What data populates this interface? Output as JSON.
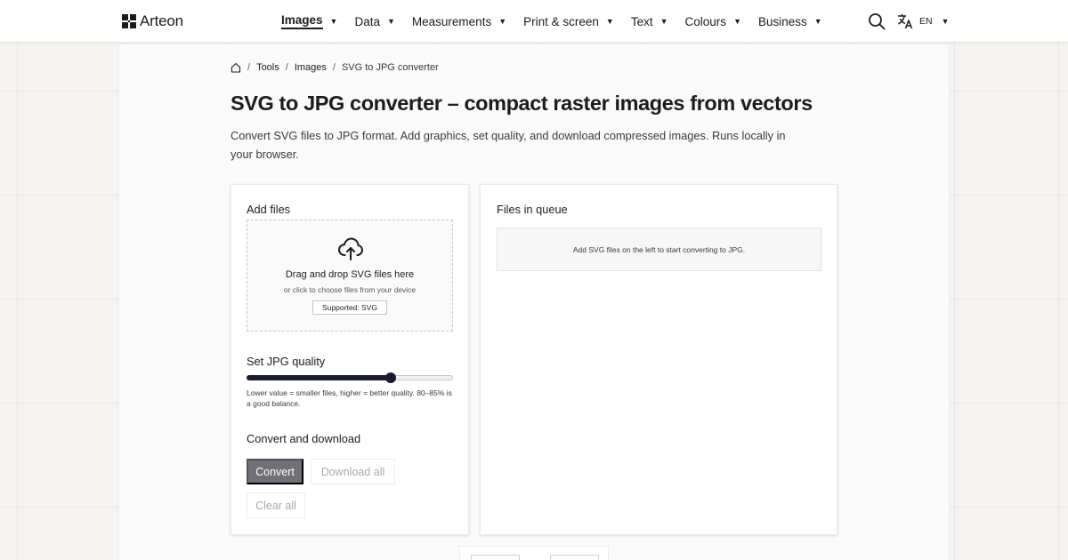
{
  "brand": {
    "name": "Arteon",
    "icon": "arteon-logo-icon"
  },
  "nav": {
    "items": [
      {
        "label": "Images",
        "active": true
      },
      {
        "label": "Data",
        "active": false
      },
      {
        "label": "Measurements",
        "active": false
      },
      {
        "label": "Print & screen",
        "active": false
      },
      {
        "label": "Text",
        "active": false
      },
      {
        "label": "Colours",
        "active": false
      },
      {
        "label": "Business",
        "active": false
      }
    ],
    "caret": "▼",
    "search_icon": "search-icon",
    "language": {
      "icon": "translate-icon",
      "code": "EN"
    }
  },
  "breadcrumb": {
    "home_icon": "home-icon",
    "separator": "/",
    "items": [
      "Tools",
      "Images"
    ],
    "current": "SVG to JPG converter"
  },
  "page": {
    "title": "SVG to JPG converter – compact raster images from vectors",
    "description": "Convert SVG files to JPG format. Add graphics, set quality, and download compressed images. Runs locally in your browser."
  },
  "add_files": {
    "heading": "Add files",
    "dropzone": {
      "icon": "cloud-upload-icon",
      "title": "Drag and drop SVG files here",
      "subtitle": "or click to choose files from your device",
      "badge": "Supported: SVG"
    }
  },
  "quality": {
    "heading": "Set JPG quality",
    "value_fraction": 0.7,
    "hint": "Lower value = smaller files, higher = better quality. 80–85% is a good balance."
  },
  "actions": {
    "heading": "Convert and download",
    "convert_label": "Convert",
    "download_all_label": "Download all",
    "clear_all_label": "Clear all"
  },
  "queue": {
    "heading": "Files in queue",
    "empty_text": "Add SVG files on the left to start converting to JPG."
  },
  "colors": {
    "accent": "#1a1a2e",
    "convert_button": "#707077",
    "background": "#f6f4f2"
  }
}
